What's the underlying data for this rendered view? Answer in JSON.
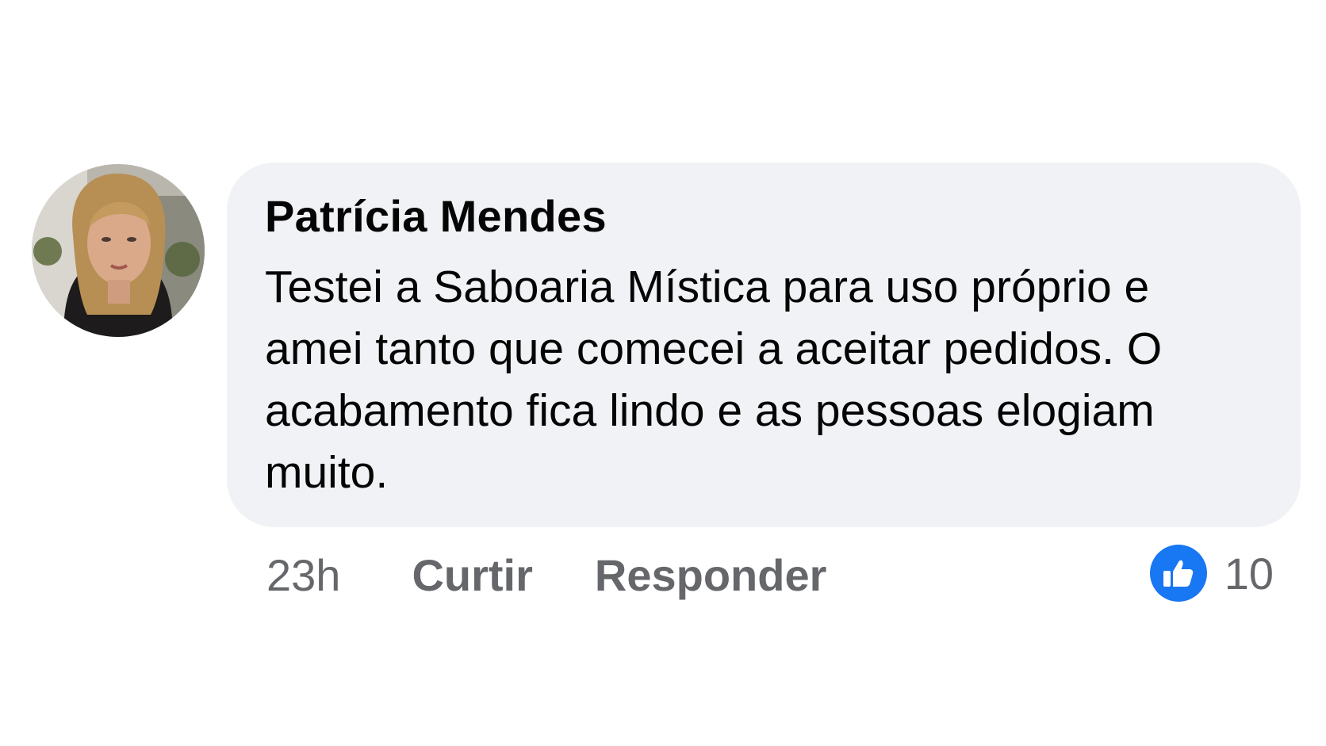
{
  "comment": {
    "author": "Patrícia Mendes",
    "text": "Testei a Saboaria Mística para uso próprio e amei tanto que comecei a aceitar pedidos. O acabamento fica lindo e as pessoas elogiam muito.",
    "time": "23h",
    "like_label": "Curtir",
    "reply_label": "Responder",
    "reaction_count": "10",
    "avatar_icon": "profile-photo",
    "reaction_icon": "thumbs-up-icon"
  },
  "colors": {
    "bubble": "#f0f2f5",
    "text": "#050505",
    "secondary": "#65676b",
    "like_blue": "#1877f2"
  }
}
